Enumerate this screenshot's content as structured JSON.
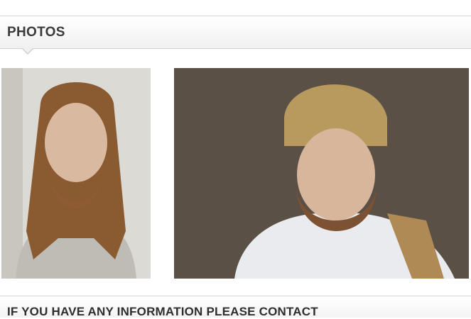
{
  "section": {
    "title": "PHOTOS"
  },
  "photos": [
    {
      "name": "photo-1"
    },
    {
      "name": "photo-2"
    }
  ],
  "contact": {
    "title": "IF YOU HAVE ANY INFORMATION PLEASE CONTACT"
  }
}
